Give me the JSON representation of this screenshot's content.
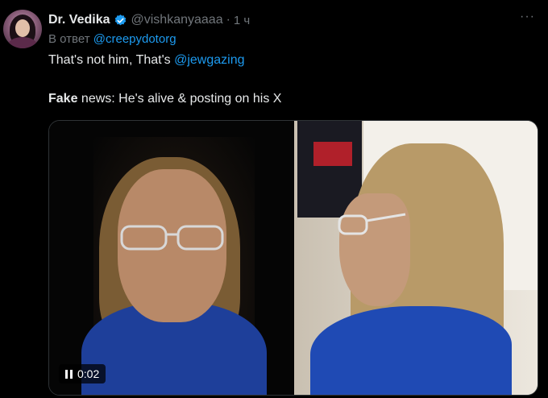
{
  "author": {
    "display_name": "Dr. Vedika",
    "handle": "@vishkanyaaaa",
    "separator": "·",
    "time": "1 ч"
  },
  "more_label": "···",
  "reply": {
    "prefix": "В ответ",
    "mention": "@creepydotorg"
  },
  "text_line1": {
    "before": "That's not him, That's ",
    "mention": "@jewgazing"
  },
  "text_line2": {
    "bold": "Fake",
    "rest": " news: He's alive & posting on his X"
  },
  "video": {
    "time": "0:02",
    "state_icon": "pause-icon"
  },
  "colors": {
    "background": "#000000",
    "text": "#e7e9ea",
    "muted": "#71767b",
    "accent": "#1d9bf0"
  }
}
